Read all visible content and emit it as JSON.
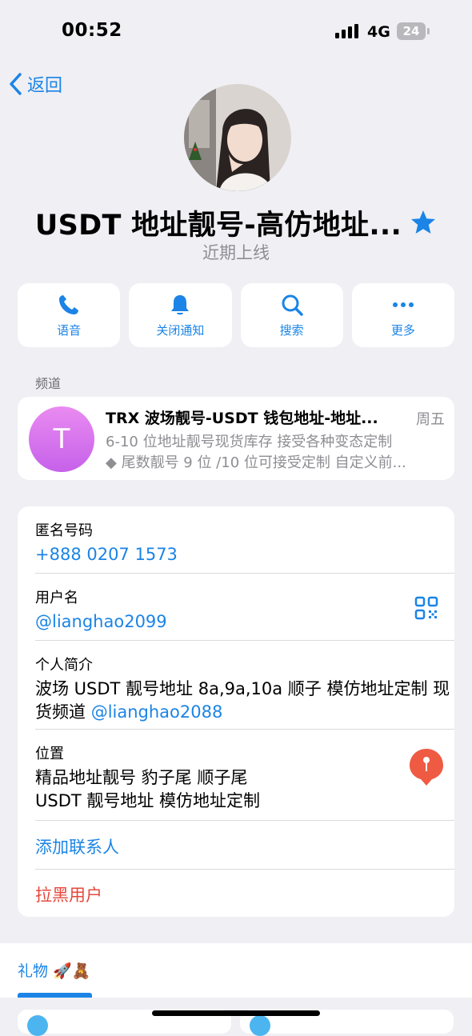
{
  "status_bar": {
    "time": "00:52",
    "network": "4G",
    "battery": "24"
  },
  "nav": {
    "back_label": "返回"
  },
  "profile": {
    "name": "USDT 地址靓号-高仿地址...",
    "last_seen": "近期上线"
  },
  "actions": [
    {
      "label": "语音",
      "icon": "phone-icon"
    },
    {
      "label": "关闭通知",
      "icon": "bell-icon"
    },
    {
      "label": "搜索",
      "icon": "search-icon"
    },
    {
      "label": "更多",
      "icon": "more-icon"
    }
  ],
  "channel_section": {
    "label": "频道",
    "avatar_letter": "T",
    "title": "TRX 波场靓号-USDT 钱包地址-地址...",
    "day": "周五",
    "line1": "6-10 位地址靓号现货库存 接受各种变态定制",
    "line2": "◆ 尾数靓号 9 位 /10 位可接受定制 自定义前..."
  },
  "info": {
    "phone_label": "匿名号码",
    "phone_value": "+888 0207 1573",
    "username_label": "用户名",
    "username_value": "@lianghao2099",
    "bio_label": "个人简介",
    "bio_text": "波场 USDT 靓号地址 8a,9a,10a 顺子 模仿地址定制 现货频道 ",
    "bio_link": "@lianghao2088",
    "location_label": "位置",
    "location_line1": "精品地址靓号 豹子尾 顺子尾",
    "location_line2": "USDT 靓号地址 模仿地址定制",
    "add_contact": "添加联系人",
    "block_user": "拉黑用户"
  },
  "gifts": {
    "tab_label": "礼物 🚀🧸"
  },
  "colors": {
    "accent": "#1b84e6",
    "danger": "#e5483c",
    "background": "#efeff4"
  }
}
